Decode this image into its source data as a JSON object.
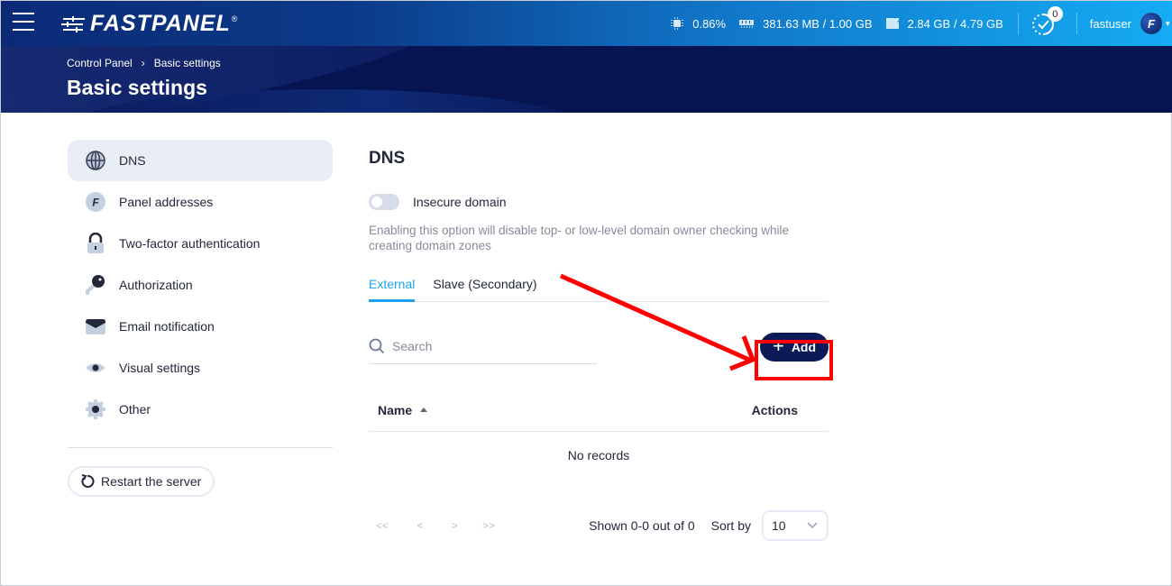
{
  "topbar": {
    "logo_text": "FASTPANEL",
    "logo_reg": "®",
    "cpu": "0.86%",
    "ram": "381.63 MB / 1.00 GB",
    "disk": "2.84 GB / 4.79 GB",
    "tasks_count": "0",
    "username": "fastuser",
    "avatar_letter": "F"
  },
  "header": {
    "breadcrumb": [
      "Control Panel",
      "Basic settings"
    ],
    "breadcrumb_sep": "›",
    "title": "Basic settings"
  },
  "sidebar": {
    "items": [
      {
        "label": "DNS",
        "icon": "globe-icon",
        "active": true
      },
      {
        "label": "Panel addresses",
        "icon": "fastpanel-f-icon"
      },
      {
        "label": "Two-factor authentication",
        "icon": "lock-icon"
      },
      {
        "label": "Authorization",
        "icon": "key-icon"
      },
      {
        "label": "Email notification",
        "icon": "envelope-icon"
      },
      {
        "label": "Visual settings",
        "icon": "eye-icon"
      },
      {
        "label": "Other",
        "icon": "gear-icon"
      }
    ],
    "restart_label": "Restart the server"
  },
  "main": {
    "title": "DNS",
    "toggle_label": "Insecure domain",
    "toggle_on": false,
    "hint": "Enabling this option will disable top- or low-level domain owner checking while creating domain zones",
    "tabs": [
      {
        "label": "External",
        "active": true
      },
      {
        "label": "Slave (Secondary)",
        "active": false
      }
    ],
    "search_placeholder": "Search",
    "add_label": "Add",
    "table": {
      "columns": [
        "Name",
        "Actions"
      ],
      "empty_text": "No records"
    },
    "pager": {
      "first": "<<",
      "prev": "<",
      "next": ">",
      "last": ">>",
      "shown": "Shown 0-0 out of 0",
      "sort_by_label": "Sort by",
      "page_size": "10"
    }
  },
  "colors": {
    "accent": "#1aa3ef",
    "primary_button": "#0c1b57",
    "header_band": "#061452",
    "annotation": "#ff0000"
  }
}
